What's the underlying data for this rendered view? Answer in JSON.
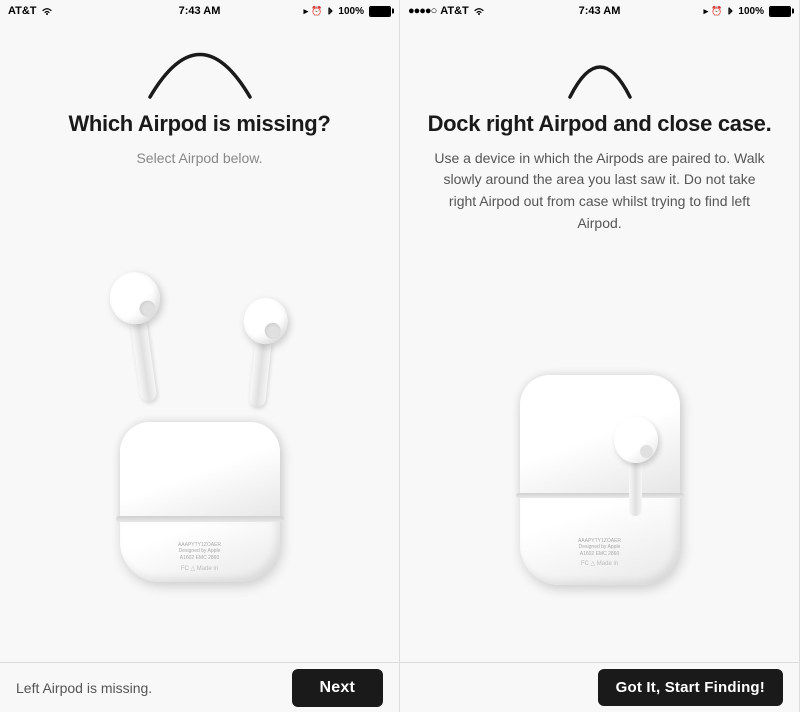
{
  "left_panel": {
    "status_bar": {
      "carrier": "AT&T",
      "signal": "●●○○○",
      "wifi": "WiFi",
      "time": "7:43 AM",
      "gps": true,
      "battery_percent": "100%",
      "bluetooth": true
    },
    "title": "Which Airpod is missing?",
    "subtitle": "Select Airpod below.",
    "bottom_label": "Left Airpod is missing.",
    "next_button": "Next"
  },
  "right_panel": {
    "status_bar": {
      "carrier": "●●●●○ AT&T",
      "wifi": "WiFi",
      "time": "7:43 AM",
      "gps": true,
      "bluetooth": true,
      "lock": true,
      "battery_percent": "100%"
    },
    "title": "Dock right Airpod and close case.",
    "description": "Use a device in which the Airpods are paired to. Walk slowly around the area you last saw it. Do not take right Airpod out from case whilst trying to find left Airpod.",
    "start_button": "Got It, Start Finding!"
  },
  "icons": {
    "wifi": "📶",
    "bluetooth": "🔵",
    "battery": "🔋"
  }
}
